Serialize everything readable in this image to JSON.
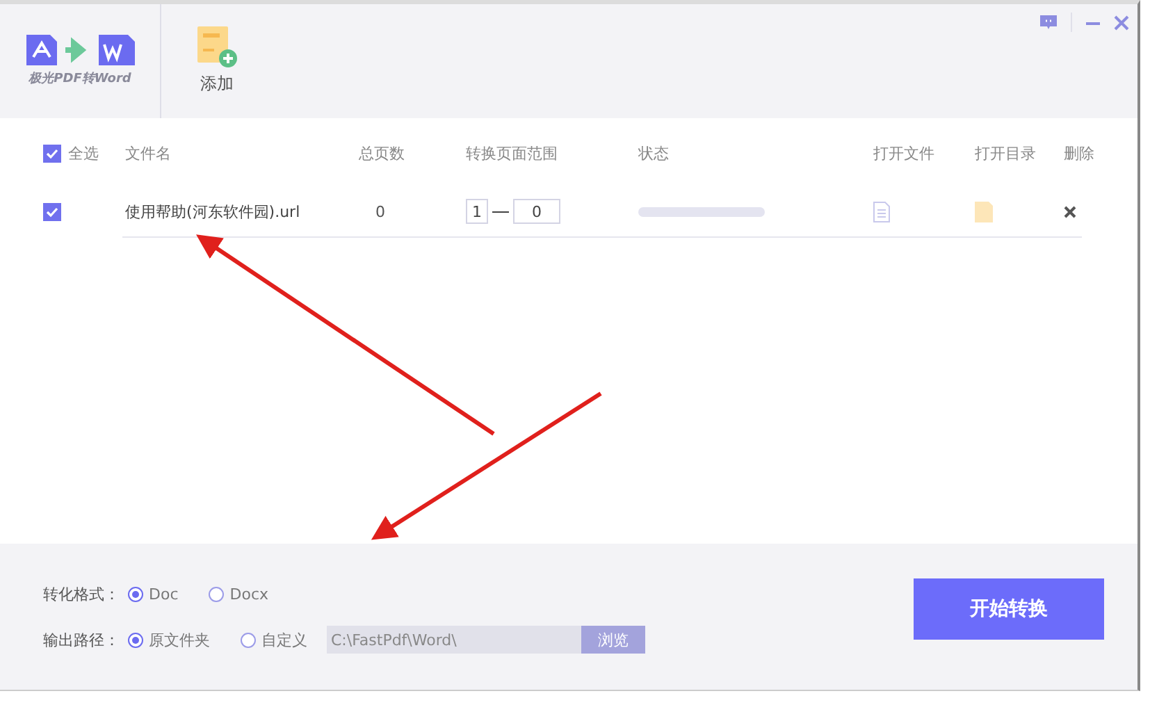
{
  "logo": {
    "text": "极光PDF转Word"
  },
  "toolbar": [
    {
      "label": "添加"
    }
  ],
  "table": {
    "select_all": {
      "label": "全选",
      "checked": true
    },
    "columns": [
      "文件名",
      "总页数",
      "转换页面范围",
      "状态",
      "打开文件",
      "打开目录",
      "删除"
    ],
    "rows": [
      {
        "checked": true,
        "name": "使用帮助(河东软件园).url",
        "pages": "0",
        "range_from": "1",
        "range_to": "0"
      }
    ]
  },
  "settings": [
    {
      "label": "转化格式：",
      "options": [
        {
          "label": "Doc",
          "selected": true
        },
        {
          "label": "Docx",
          "selected": false
        }
      ]
    },
    {
      "label": "输出路径：",
      "options": [
        {
          "label": "原文件夹",
          "selected": true
        },
        {
          "label": "自定义",
          "selected": false
        }
      ],
      "path": "C:\\FastPdf\\Word\\",
      "browse": "浏览"
    }
  ],
  "start_button": "开始转换"
}
